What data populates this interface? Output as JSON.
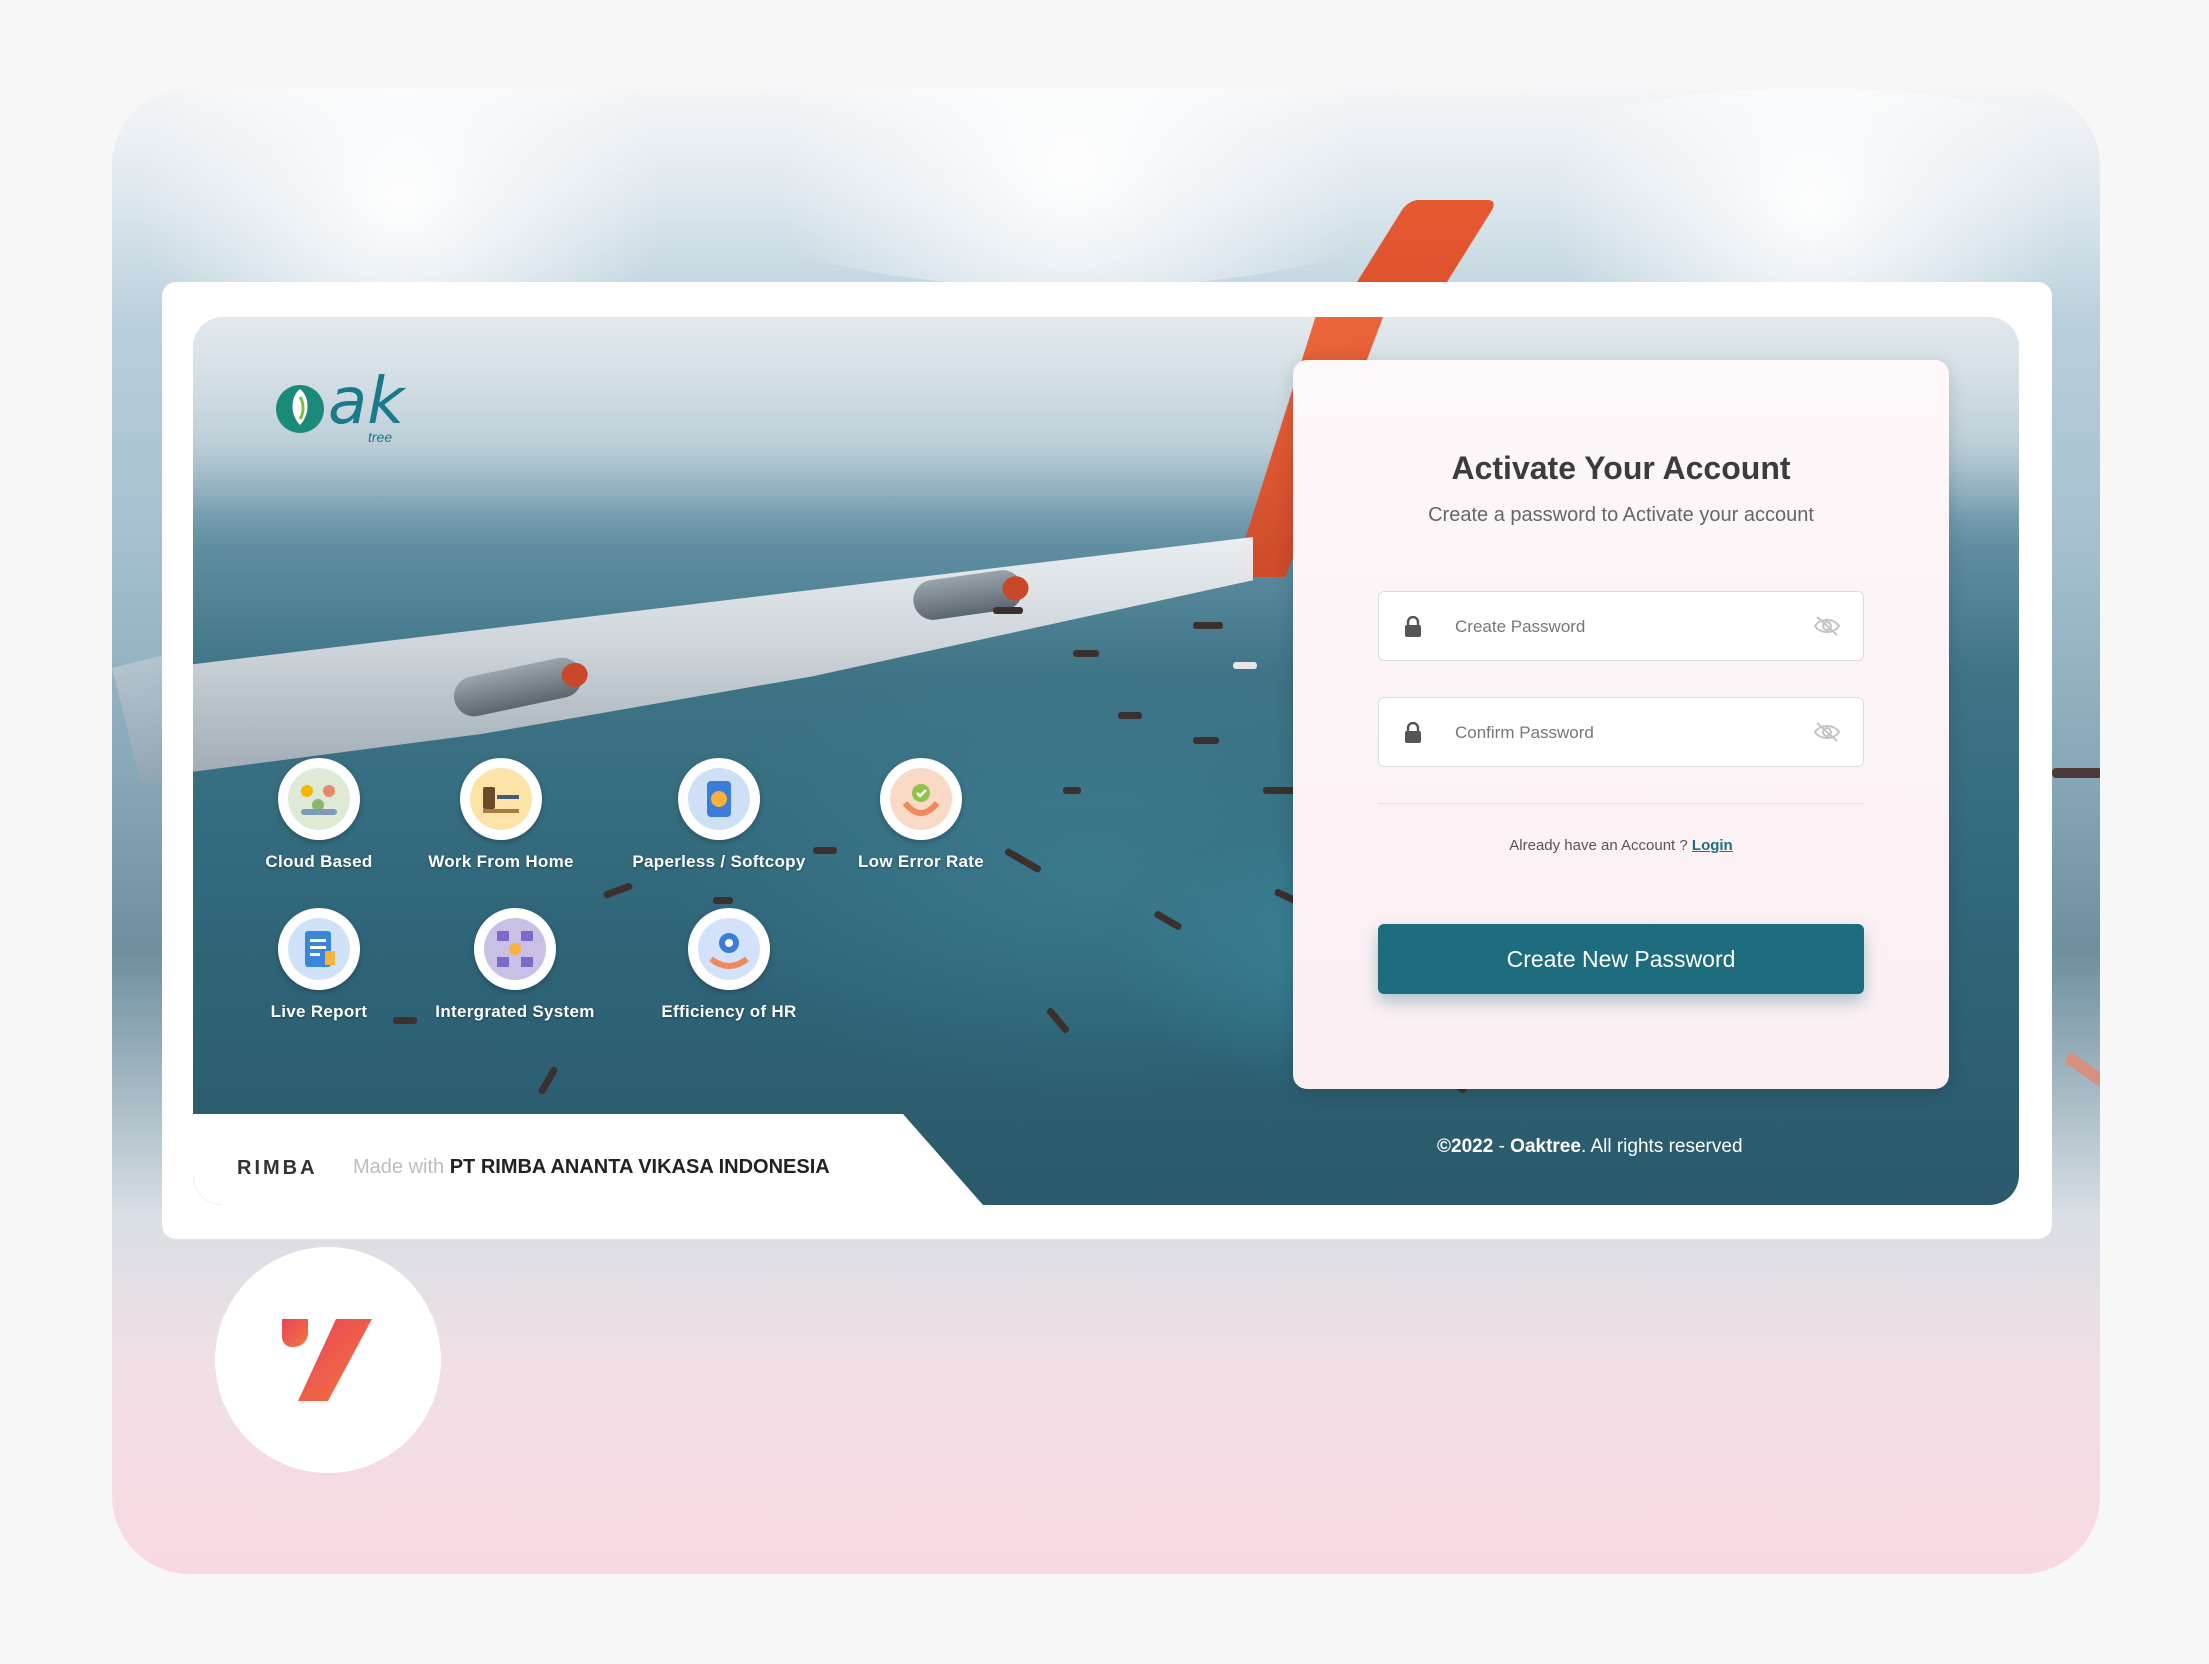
{
  "brand": {
    "logo_text": "ak",
    "logo_sub": "tree"
  },
  "features": [
    {
      "label": "Cloud Based",
      "icon": "cloud-team-icon"
    },
    {
      "label": "Work From Home",
      "icon": "laptop-desk-icon"
    },
    {
      "label": "Paperless / Softcopy",
      "icon": "phone-document-icon"
    },
    {
      "label": "Low Error Rate",
      "icon": "hand-check-icon"
    },
    {
      "label": "Live Report",
      "icon": "report-clipboard-icon"
    },
    {
      "label": "Intergrated System",
      "icon": "network-nodes-icon"
    },
    {
      "label": "Efficiency of HR",
      "icon": "hand-gear-icon"
    }
  ],
  "footer": {
    "rimba": "RIMBA",
    "made_with": "Made with",
    "company": "PT RIMBA ANANTA VIKASA INDONESIA",
    "copyright_year": "©2022",
    "copyright_sep": "-",
    "copyright_brand": "Oaktree",
    "copyright_rest": ". All rights reserved"
  },
  "form": {
    "title": "Activate Your Account",
    "subtitle": "Create a password to Activate your account",
    "password_placeholder": "Create Password",
    "confirm_placeholder": "Confirm Password",
    "already_text": "Already have an Account ?",
    "login_link": "Login",
    "submit_label": "Create New Password"
  },
  "colors": {
    "primary": "#1e6d7e",
    "accent_orange": "#e65a33",
    "badge_gradient_start": "#e8435a",
    "badge_gradient_end": "#f4763c"
  }
}
